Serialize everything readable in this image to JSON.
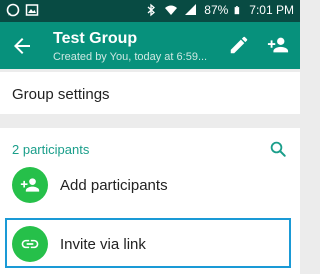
{
  "status_bar": {
    "battery_pct": "87%",
    "time": "7:01 PM",
    "icons": [
      "whatsapp-icon",
      "gallery-icon",
      "bluetooth-icon",
      "wifi-icon",
      "signal-icon",
      "battery-icon"
    ]
  },
  "app_bar": {
    "title": "Test Group",
    "subtitle": "Created by You, today at 6:59...",
    "icons": [
      "back-arrow-icon",
      "pencil-edit-icon",
      "add-person-icon"
    ]
  },
  "group_settings_label": "Group settings",
  "participants": {
    "count_label": "2 participants",
    "add_label": "Add participants",
    "invite_label": "Invite via link"
  },
  "colors": {
    "status_bar": "#084b43",
    "app_bar": "#07917c",
    "accent_green": "#26c04a",
    "teal_text": "#1a9e8a",
    "highlight_border": "#1a9ad6"
  }
}
